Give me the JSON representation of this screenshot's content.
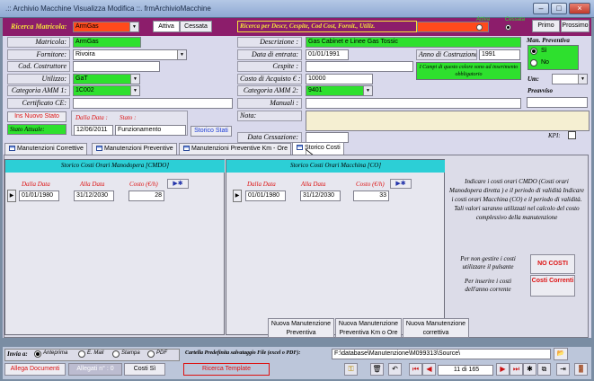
{
  "window": {
    "title": ".:: Archivio Macchine Visualizza Modifica ::.   frmArchivioMacchine"
  },
  "header": {
    "ricerca_matricola_label": "Ricerca Matricola:",
    "ricerca_matricola_value": "ArmGas",
    "toggle_attiva": "Attiva",
    "toggle_cessata": "Cessata",
    "ricerca_desc_label": "Ricerca per Descr, Cespite, Cod Cost, Fornit., Utiliz.",
    "ricerca_desc_value": "",
    "radio_attiva": "Attiva",
    "radio_cessata": "Cessata",
    "primo_label": "Primo",
    "prossimo_label": "Prossimo"
  },
  "left_fields": {
    "matricola": {
      "label": "Matricola:",
      "value": "ArmGas"
    },
    "fornitore": {
      "label": "Fornitore:",
      "value": "Rivoira"
    },
    "cod_costruttore": {
      "label": "Cod. Costruttore",
      "value": ""
    },
    "utilizzo": {
      "label": "Utilizzo:",
      "value": "GaT"
    },
    "categoria_amm1": {
      "label": "Categoria AMM 1:",
      "value": "1C002"
    },
    "certificato_ce": {
      "label": "Certificato CE:",
      "value": ""
    }
  },
  "right_fields": {
    "descrizione": {
      "label": "Descrizione :",
      "value": "Gas Cabinet e Linee Gas Tossic"
    },
    "data_entrata": {
      "label": "Data di entrata:",
      "value": "01/01/1991"
    },
    "anno_costruzione": {
      "label": "Anno di Costruzione:",
      "value": "1991"
    },
    "cespite": {
      "label": "Cespite :",
      "value": ""
    },
    "costo_acquisto": {
      "label": "Costo di Acquisto € :",
      "value": "10000"
    },
    "categoria_amm2": {
      "label": "Categoria AMM 2:",
      "value": "9401"
    },
    "manuali": {
      "label": "Manuali :",
      "value": ""
    },
    "nota": {
      "label": "Nota:",
      "value": ""
    },
    "data_cessazione": {
      "label": "Data Cessazione:",
      "value": ""
    },
    "mandatory_note": "I Campi di questo colore sono ad inserimento obbligatorio"
  },
  "far_right": {
    "man_preventiva_label": "Man. Preventiva",
    "si_label": "Sì",
    "no_label": "No",
    "um_label": "Um:",
    "um_value": "",
    "preavviso_label": "Preavviso",
    "kpi_label": "KPI:"
  },
  "stato": {
    "ins_nuovo_stato": "Ins Nuovo Stato",
    "stato_attuale_label": "Stato Attuale:",
    "dalla_data_label": "Dalla Data :",
    "stato_label": "Stato :",
    "dalla_data_value": "12/06/2011",
    "stato_value": "Funzionamento",
    "storico_stati": "Storico Stati"
  },
  "tabs": [
    {
      "label": "Manutenzioni Correttive"
    },
    {
      "label": "Manutenzioni Preventive"
    },
    {
      "label": "Manutenzioni Preventive Km - Ore"
    },
    {
      "label": "Storico Costi"
    }
  ],
  "costi": {
    "cmdo_header": "Storico Costi Orari Manodopera [CMDO]",
    "co_header": "Storico Costi Orari Macchina [CO]",
    "col_dalla": "Dalla Data",
    "col_alla": "Alla Data",
    "col_costo": "Costo (€/h)",
    "cmdo_row": {
      "dalla": "01/01/1980",
      "alla": "31/12/2030",
      "costo": "28"
    },
    "co_row": {
      "dalla": "01/01/1980",
      "alla": "31/12/2030",
      "costo": "33"
    },
    "info_text": "Indicare i costi orari CMDO (Costi orari Manodopera diretta ) e il periodo di validità Indicare i costi orari Macchina (CO) e il periodo di validità. Tali  valori saranno utilizzati nel calcolo del costo complessivo della manutenzione",
    "no_costi_note": "Per non gestire i costi utilizzare il pulsante",
    "no_costi_btn": "NO COSTI",
    "correnti_note": "Per inserire i costi dell'anno corrente",
    "correnti_btn": "Costi Correnti"
  },
  "new_buttons": [
    {
      "label": "Nuova Manutenzione Preventiva"
    },
    {
      "label": "Nuova Manutenzione Preventiva Km o Ore"
    },
    {
      "label": "Nuova Manutenzione correttiva"
    }
  ],
  "bottom": {
    "invia_label": "Invia a:",
    "anteprima": "Anteprima",
    "email": "E. Mail",
    "stampa": "Stampa",
    "pdf": "PDF",
    "cartella_label": "Cartella Predefinita  salvataggio File (excel o PDF):",
    "cartella_value": "F:\\database\\Manutenzione\\M099313\\Source\\",
    "allega_documenti": "Allega Documenti",
    "allegati": "Allegati n° : 0",
    "costi_si": "Costi Sì",
    "ricerca_template": "Ricerca Template",
    "record_counter": "11 di 165"
  }
}
